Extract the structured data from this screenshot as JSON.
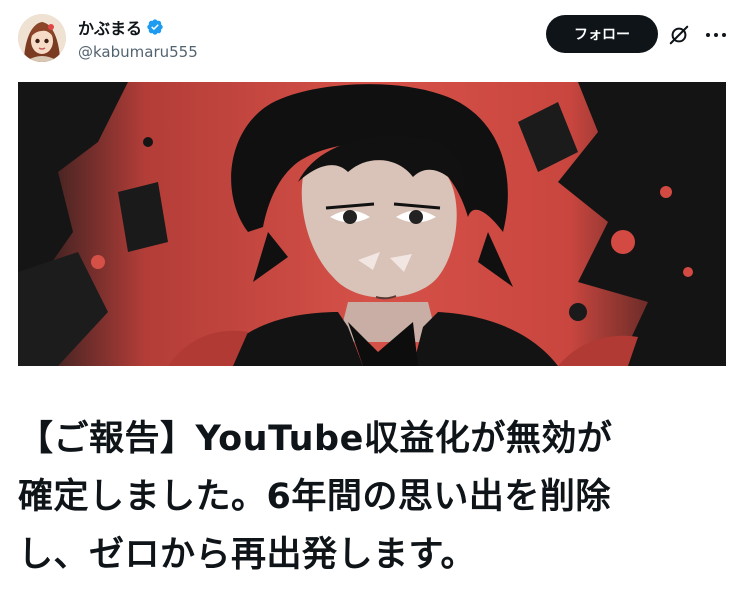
{
  "user": {
    "display_name": "かぶまる",
    "handle": "@kabumaru555",
    "verified": true,
    "avatar_icon": "user-avatar"
  },
  "actions": {
    "follow_label": "フォロー",
    "grok_icon": "slash-circle-icon",
    "more_icon": "more-icon"
  },
  "media": {
    "type": "image",
    "description_icon": "anime-illustration",
    "accent_color": "#cf4c45"
  },
  "tweet": {
    "lines": [
      "【ご報告】YouTube収益化が無効が",
      "確定しました。6年間の思い出を削除",
      "し、ゼロから再出発します。"
    ]
  },
  "colors": {
    "text_primary": "#0f1419",
    "text_secondary": "#536471",
    "verified_blue": "#1d9bf0",
    "button_bg": "#0f1419"
  }
}
